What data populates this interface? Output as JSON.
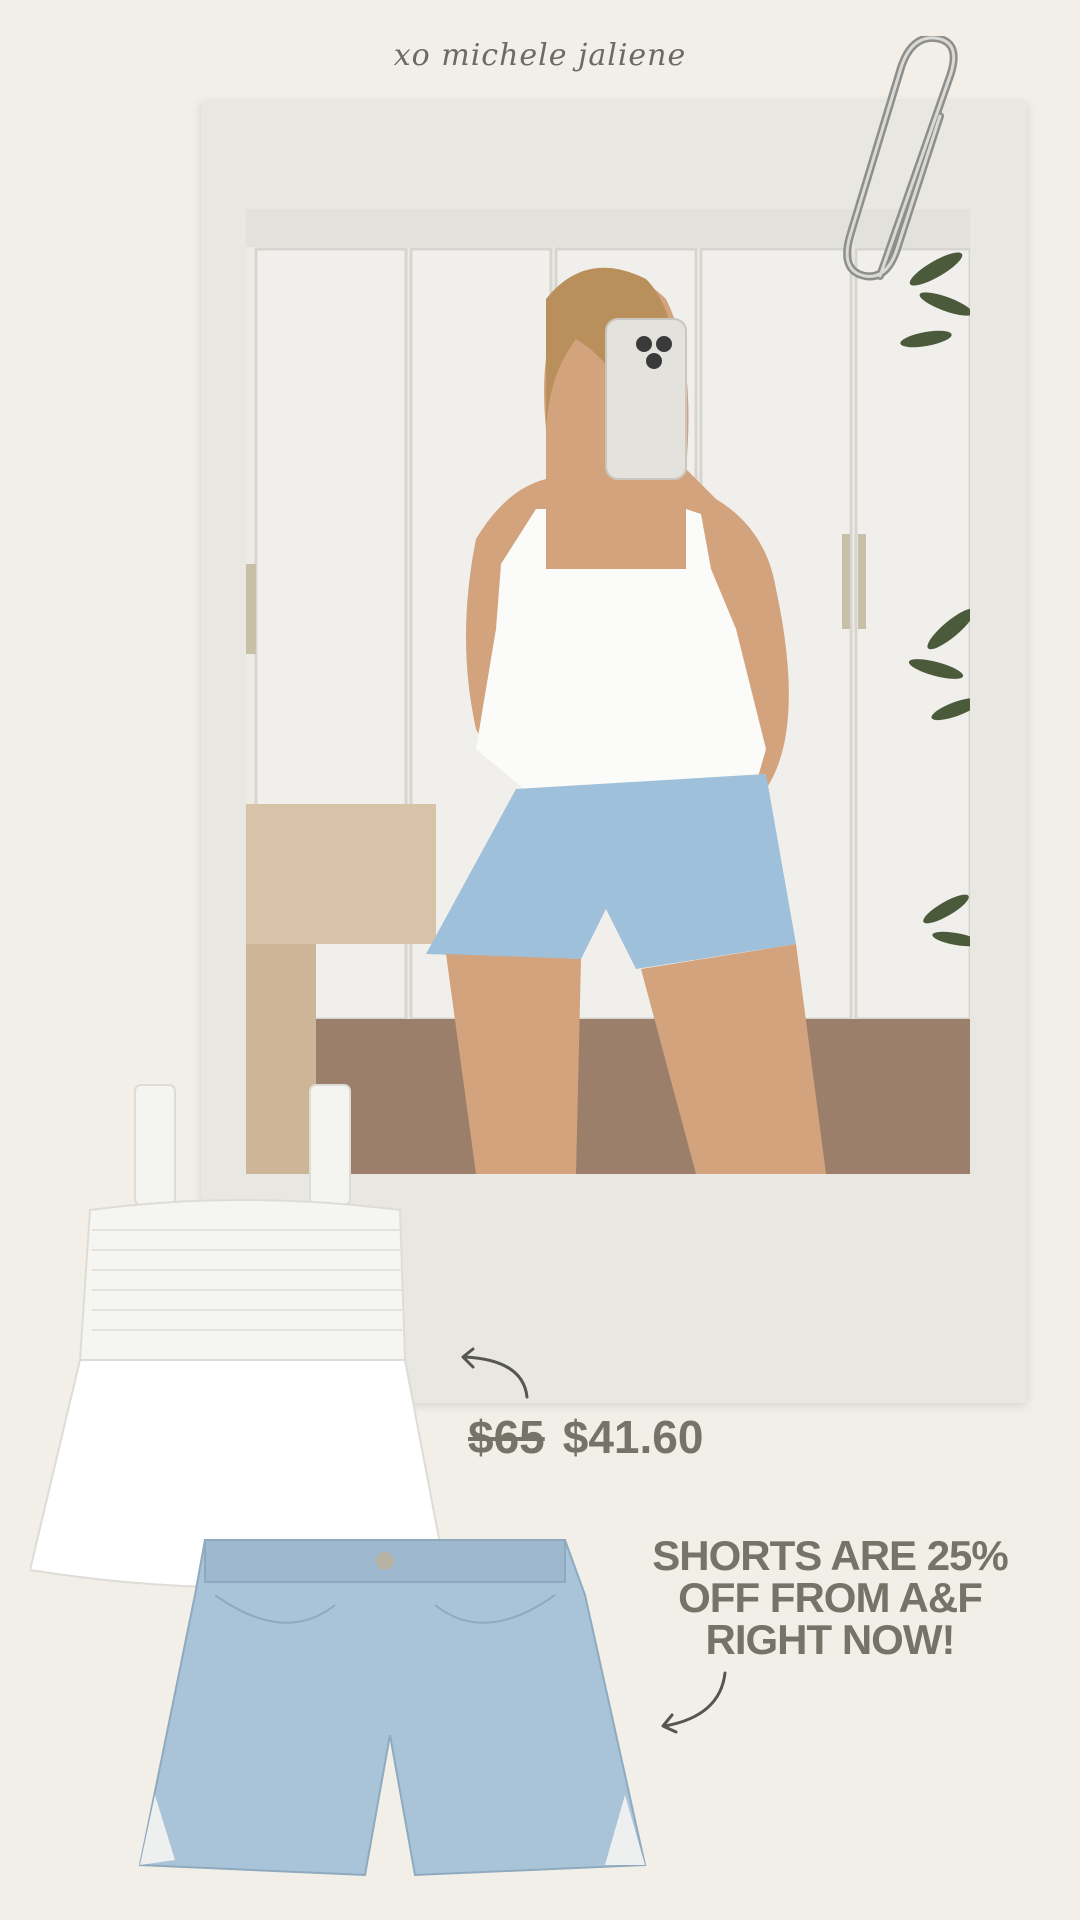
{
  "signature": "xo michele jaliene",
  "price": {
    "original": "$65",
    "sale": "$41.60"
  },
  "promo": {
    "line1": "SHORTS ARE 25%",
    "line2": "OFF FROM A&F",
    "line3": "RIGHT NOW!"
  },
  "colors": {
    "background": "#f1efe8",
    "text_accent": "#767369",
    "denim": "#a9c3d8",
    "top_white": "#ffffff"
  },
  "icons": [
    "paperclip-icon",
    "curved-arrow-icon"
  ]
}
